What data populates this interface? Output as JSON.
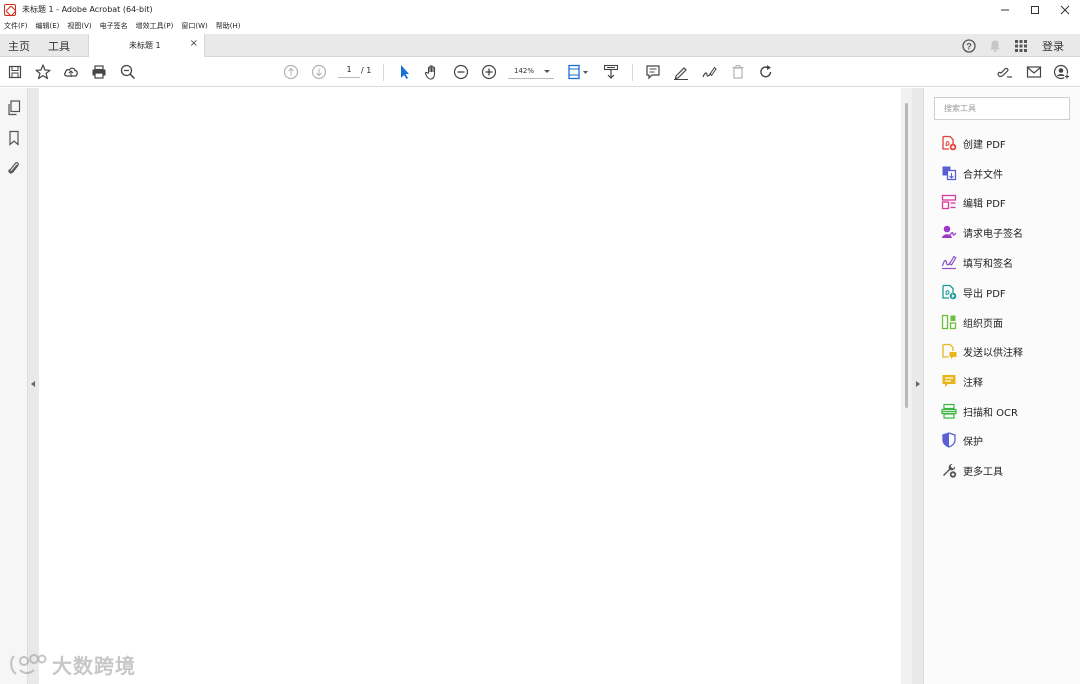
{
  "window": {
    "title": "未标题 1 - Adobe Acrobat (64-bit)"
  },
  "menu": [
    "文件(F)",
    "编辑(E)",
    "视图(V)",
    "电子签名",
    "增效工具(P)",
    "窗口(W)",
    "帮助(H)"
  ],
  "tabs": {
    "home": "主页",
    "tools": "工具",
    "document": "未标题 1",
    "close": "×",
    "login": "登录"
  },
  "toolbar": {
    "page_current": "1",
    "page_total": "/ 1",
    "zoom": "142%"
  },
  "tools_panel": {
    "search_placeholder": "搜索工具",
    "items": [
      {
        "label": "创建 PDF",
        "icon": "create-pdf-icon",
        "color": "#e0413a"
      },
      {
        "label": "合并文件",
        "icon": "combine-files-icon",
        "color": "#5a5fd6"
      },
      {
        "label": "编辑 PDF",
        "icon": "edit-pdf-icon",
        "color": "#d63a9a"
      },
      {
        "label": "请求电子签名",
        "icon": "request-signature-icon",
        "color": "#9a3ac9"
      },
      {
        "label": "填写和签名",
        "icon": "fill-sign-icon",
        "color": "#8a53c9"
      },
      {
        "label": "导出 PDF",
        "icon": "export-pdf-icon",
        "color": "#1b9a9a"
      },
      {
        "label": "组织页面",
        "icon": "organize-pages-icon",
        "color": "#6fbf3f"
      },
      {
        "label": "发送以供注释",
        "icon": "send-comments-icon",
        "color": "#e8b51c"
      },
      {
        "label": "注释",
        "icon": "comment-icon",
        "color": "#e8b51c"
      },
      {
        "label": "扫描和 OCR",
        "icon": "scan-ocr-icon",
        "color": "#3ab53f"
      },
      {
        "label": "保护",
        "icon": "protect-icon",
        "color": "#5a5fd6"
      },
      {
        "label": "更多工具",
        "icon": "more-tools-icon",
        "color": "#555555"
      }
    ]
  },
  "watermark": {
    "text": "大数跨境"
  }
}
